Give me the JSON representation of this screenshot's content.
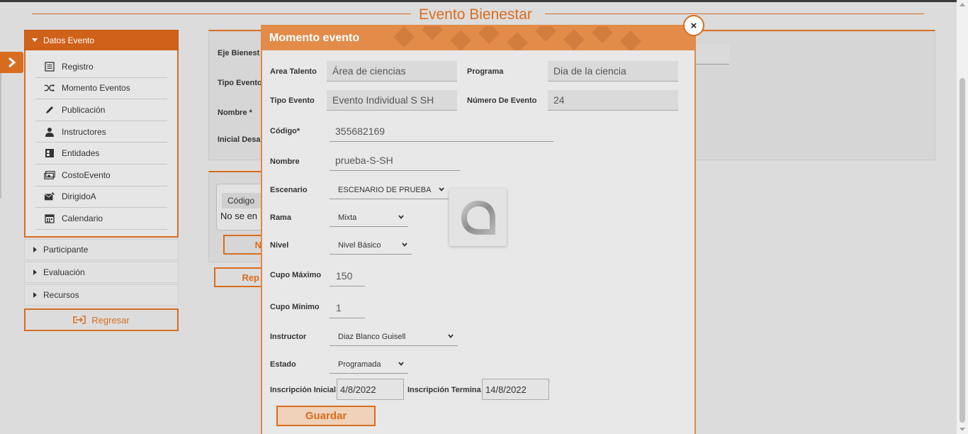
{
  "page": {
    "title": "Evento Bienestar",
    "accent_color": "#d86d1f"
  },
  "sidebar": {
    "active_section": "Datos Evento",
    "items": [
      {
        "label": "Registro",
        "icon": "list-icon"
      },
      {
        "label": "Momento Eventos",
        "icon": "shuffle-icon"
      },
      {
        "label": "Publicación",
        "icon": "pencil-icon"
      },
      {
        "label": "Instructores",
        "icon": "user-icon"
      },
      {
        "label": "Entidades",
        "icon": "id-card-icon"
      },
      {
        "label": "CostoEvento",
        "icon": "money-icon"
      },
      {
        "label": "DirigidoA",
        "icon": "mail-icon"
      },
      {
        "label": "Calendario",
        "icon": "calendar-icon"
      }
    ],
    "sections": [
      "Participante",
      "Evaluación",
      "Recursos"
    ],
    "back_label": "Regresar"
  },
  "background_form": {
    "labels": [
      "Eje Bienest",
      "Tipo Evento",
      "Nombre *",
      "Inicial Desa"
    ],
    "table_header": "Código",
    "table_empty": "No se en",
    "btn1": "N",
    "btn2": "Rep"
  },
  "modal": {
    "title": "Momento evento",
    "close_symbol": "×",
    "fields": {
      "area_talento": {
        "label": "Area Talento",
        "value": "Área de ciencias"
      },
      "programa": {
        "label": "Programa",
        "value": "Dia de la ciencia"
      },
      "tipo_evento": {
        "label": "Tipo Evento",
        "value": "Evento Individual S SH"
      },
      "numero_evento": {
        "label": "Número De Evento",
        "value": "24"
      },
      "codigo": {
        "label": "Código*",
        "value": "355682169"
      },
      "nombre": {
        "label": "Nombre",
        "value": "prueba-S-SH"
      },
      "escenario": {
        "label": "Escenario",
        "value": "ESCENARIO DE PRUEBA"
      },
      "rama": {
        "label": "Rama",
        "value": "Mixta"
      },
      "nivel": {
        "label": "Nivel",
        "value": "Nivel Básico"
      },
      "cupo_maximo": {
        "label": "Cupo Máximo",
        "value": "150"
      },
      "cupo_minimo": {
        "label": "Cupo Minimo",
        "value": "1"
      },
      "instructor": {
        "label": "Instructor",
        "value": "Diaz Blanco Guisell"
      },
      "estado": {
        "label": "Estado",
        "value": "Programada"
      },
      "inscripcion_inicial": {
        "label": "Inscripción Inicial",
        "value": "4/8/2022"
      },
      "inscripcion_termina": {
        "label": "Inscripción Termina",
        "value": "14/8/2022"
      }
    },
    "save_label": "Guardar"
  }
}
